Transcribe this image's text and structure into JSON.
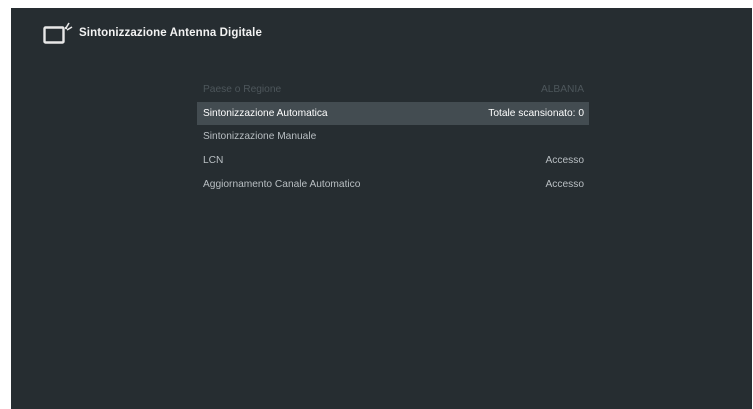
{
  "header": {
    "title": "Sintonizzazione Antenna Digitale",
    "icon": "tv-antenna-icon"
  },
  "menu": {
    "items": [
      {
        "label": "Paese o Regione",
        "value": "ALBANIA",
        "state": "disabled"
      },
      {
        "label": "Sintonizzazione Automatica",
        "value": "Totale scansionato: 0",
        "state": "selected"
      },
      {
        "label": "Sintonizzazione Manuale",
        "value": "",
        "state": "normal"
      },
      {
        "label": "LCN",
        "value": "Accesso",
        "state": "normal"
      },
      {
        "label": "Aggiornamento Canale Automatico",
        "value": "Accesso",
        "state": "normal"
      }
    ]
  },
  "colors": {
    "background": "#262d31",
    "selected_row": "#434c51",
    "text_normal": "#b9bfc3",
    "text_disabled": "#4d565b",
    "text_selected": "#ffffff"
  }
}
